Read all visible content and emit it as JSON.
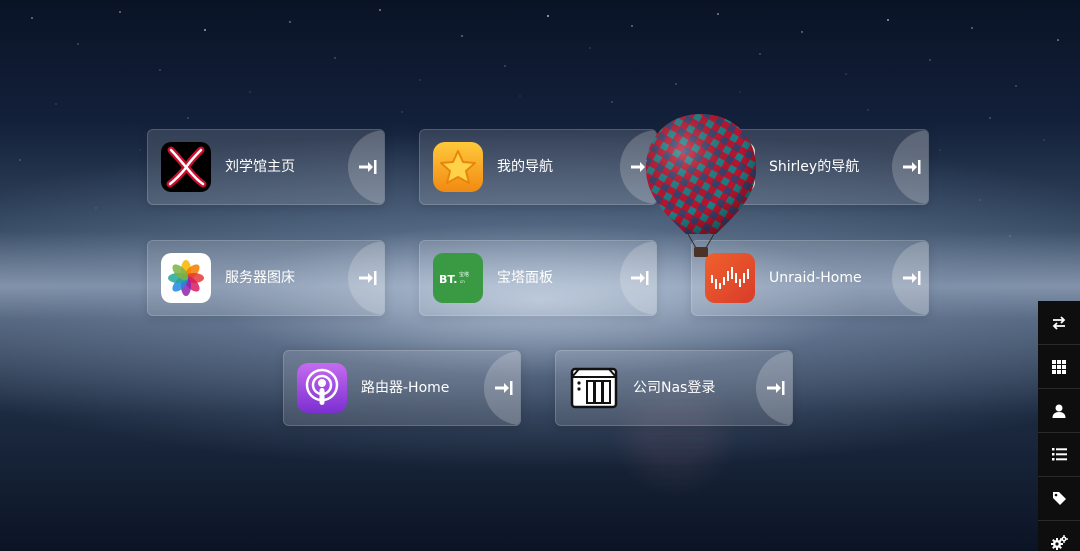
{
  "bookmarks": [
    {
      "name": "刘学馆主页",
      "icon": "x-logo-icon"
    },
    {
      "name": "我的导航",
      "icon": "star-icon"
    },
    {
      "name": "Shirley的导航",
      "icon": "photo-thumbnail-icon"
    },
    {
      "name": "服务器图床",
      "icon": "photos-flower-icon"
    },
    {
      "name": "宝塔面板",
      "icon": "bt-panel-icon",
      "icon_text": "BT.",
      "icon_subtext": "宝塔",
      "icon_subtext2": "cn"
    },
    {
      "name": "Unraid-Home",
      "icon": "unraid-icon"
    },
    {
      "name": "路由器-Home",
      "icon": "podcasts-icon"
    },
    {
      "name": "公司Nas登录",
      "icon": "nas-server-icon"
    }
  ],
  "sidebar": {
    "buttons": [
      {
        "icon": "swap-arrows-icon"
      },
      {
        "icon": "grid-icon"
      },
      {
        "icon": "user-icon"
      },
      {
        "icon": "list-icon"
      },
      {
        "icon": "tag-icon"
      },
      {
        "icon": "settings-gears-icon"
      }
    ]
  },
  "colors": {
    "card_bg": "#ffffff22",
    "sidebar_bg": "#0e0e0e",
    "bt_green": "#3a9a44",
    "unraid_orange": "#e8542a",
    "podcasts_purple": "#9b3fdc"
  }
}
